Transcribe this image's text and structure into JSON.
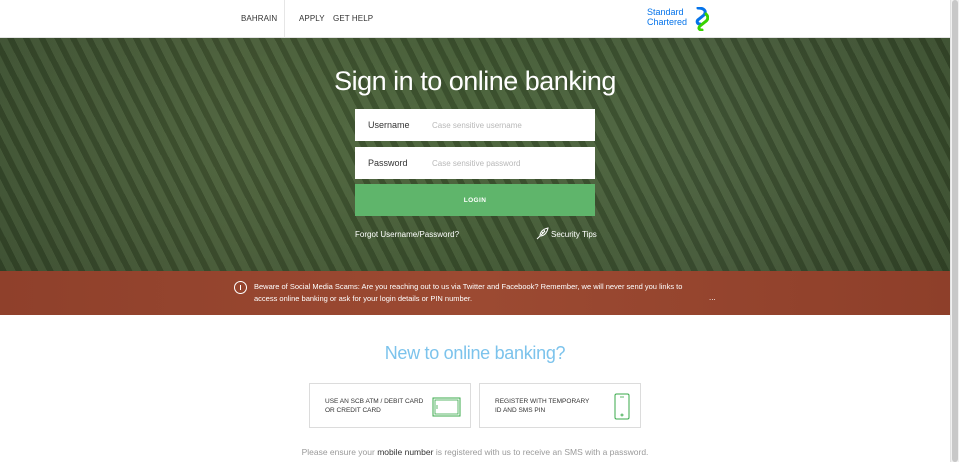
{
  "header": {
    "country": "BAHRAIN",
    "nav": [
      "APPLY",
      "GET HELP"
    ],
    "logo": {
      "line1": "Standard",
      "line2": "Chartered"
    }
  },
  "login": {
    "title": "Sign in to online banking",
    "username_label": "Username",
    "username_placeholder": "Case sensitive username",
    "password_label": "Password",
    "password_placeholder": "Case sensitive password",
    "login_button": "LOGIN",
    "forgot_link": "Forgot Username/Password?",
    "security_tips": "Security Tips"
  },
  "alert": {
    "message": "Beware of Social Media Scams: Are you reaching out to us via Twitter and Facebook? Remember, we will never send you links to access online banking or ask for your login details or PIN number.",
    "more": "..."
  },
  "new_user": {
    "title": "New to online banking?",
    "options": [
      {
        "label": "USE AN SCB ATM / DEBIT CARD OR CREDIT CARD",
        "icon": "credit-card-icon"
      },
      {
        "label": "REGISTER WITH TEMPORARY ID AND SMS PIN",
        "icon": "mobile-phone-icon"
      }
    ],
    "note_before": "Please ensure your",
    "note_strong": "mobile number",
    "note_after": "is registered with us to receive an SMS with a password."
  },
  "colors": {
    "brand_blue": "#0473ea",
    "brand_green": "#38d200",
    "login_green": "#5fb56b",
    "alert_red": "#9a4630",
    "heading_blue": "#7cc3ec"
  }
}
